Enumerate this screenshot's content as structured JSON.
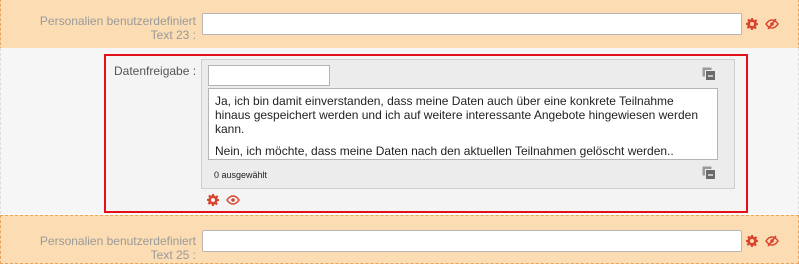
{
  "rows": {
    "top": {
      "label_line1": "Personalien benutzerdefiniert",
      "label_line2": "Text 23 :",
      "value": ""
    },
    "bottom": {
      "label_line1": "Personalien benutzerdefiniert",
      "label_line2": "Text 25 :",
      "value": ""
    }
  },
  "datenfreigabe": {
    "label": "Datenfreigabe :",
    "filter_value": "",
    "options": [
      "Ja, ich bin damit einverstanden, dass meine Daten auch über eine konkrete Teilnahme hinaus gespeichert werden und ich auf weitere interessante Angebote hingewiesen werden kann.",
      "Nein, ich möchte, dass meine Daten nach den aktuellen Teilnahmen gelöscht werden.."
    ],
    "selected_count": "0 ausgewählt"
  },
  "icons": {
    "gear": "gear-icon",
    "eye": "eye-icon",
    "eye_hidden": "eye-slash-icon",
    "copy": "copy-icon"
  },
  "colors": {
    "highlight_border": "#e3101c",
    "row_background": "#fbdcb3",
    "icon_red": "#d9442e"
  }
}
